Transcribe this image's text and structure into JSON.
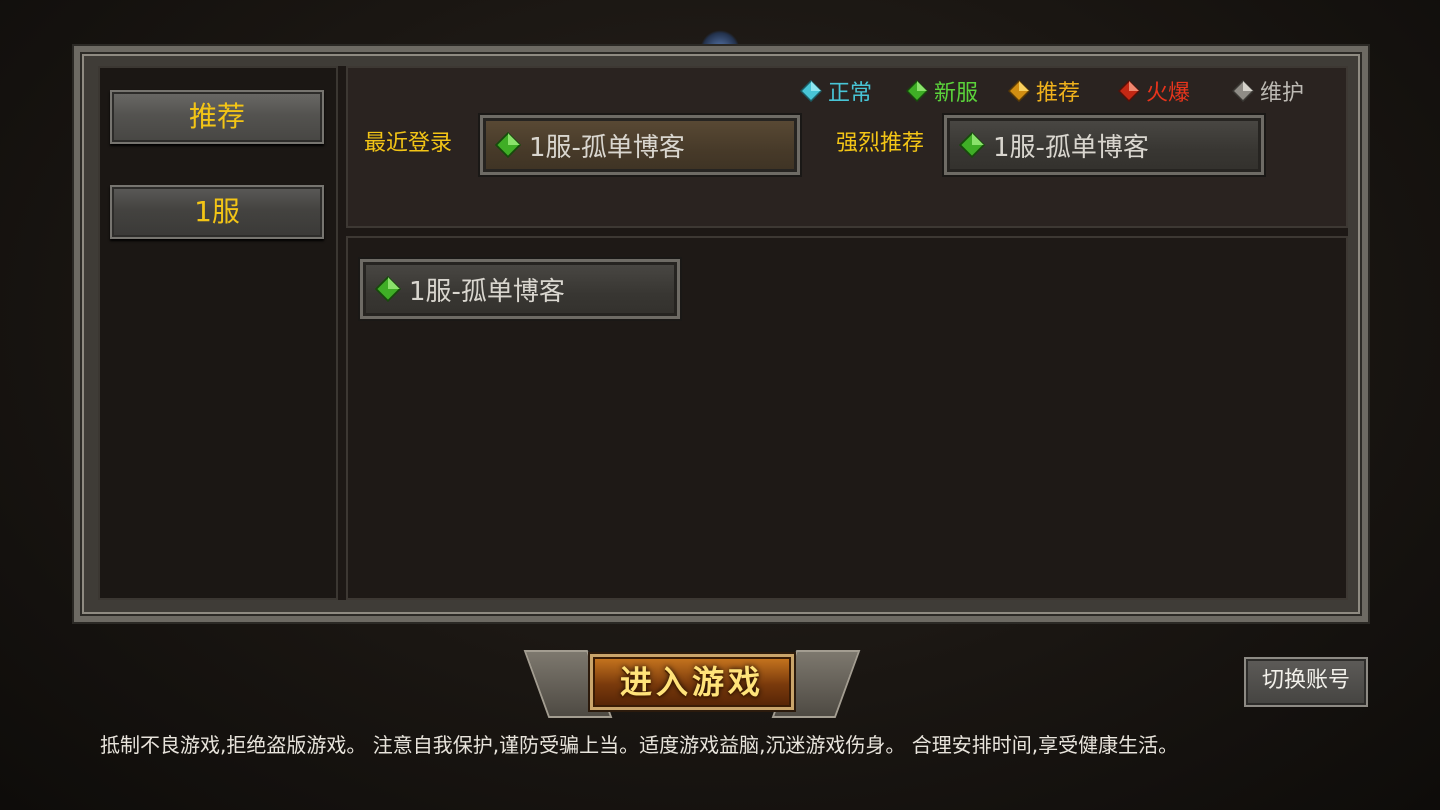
{
  "legend": [
    {
      "label": "正常",
      "color": "#48c5d6",
      "icon": "gem-cyan-icon"
    },
    {
      "label": "新服",
      "color": "#5bd33b",
      "icon": "gem-green-icon"
    },
    {
      "label": "推荐",
      "color": "#f0b21c",
      "icon": "gem-yellow-icon"
    },
    {
      "label": "火爆",
      "color": "#e8341c",
      "icon": "gem-red-icon"
    },
    {
      "label": "维护",
      "color": "#bdbab4",
      "icon": "gem-gray-icon"
    }
  ],
  "sidebar": {
    "tabs": [
      {
        "label": "推荐"
      },
      {
        "label": "1服"
      }
    ]
  },
  "top": {
    "recent_label": "最近登录",
    "recent_server": "1服-孤单博客",
    "recommend_label": "强烈推荐",
    "recommend_server": "1服-孤单博客"
  },
  "server_list": [
    {
      "name": "1服-孤单博客"
    }
  ],
  "actions": {
    "enter_game": "进入游戏",
    "switch_account": "切换账号"
  },
  "notice": "抵制不良游戏,拒绝盗版游戏。 注意自我保护,谨防受骗上当。适度游戏益脑,沉迷游戏伤身。 合理安排时间,享受健康生活。"
}
